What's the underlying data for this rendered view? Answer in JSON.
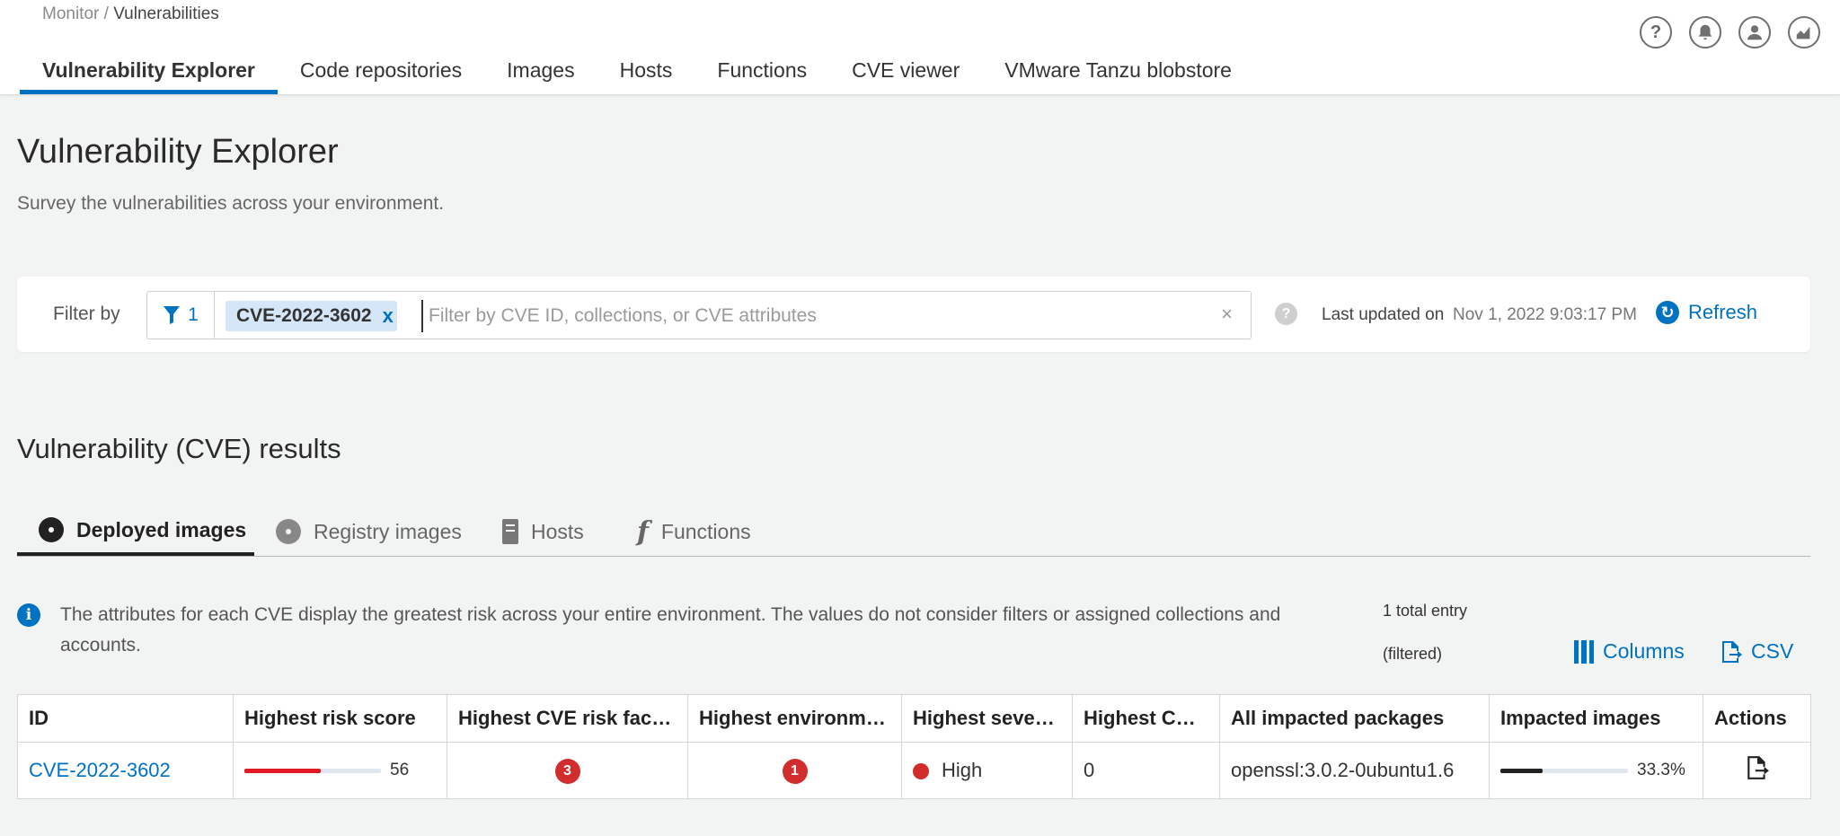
{
  "breadcrumb": {
    "parent": "Monitor",
    "separator": " / ",
    "current": "Vulnerabilities"
  },
  "nav": {
    "tabs": [
      {
        "label": "Vulnerability Explorer",
        "active": true
      },
      {
        "label": "Code repositories"
      },
      {
        "label": "Images"
      },
      {
        "label": "Hosts"
      },
      {
        "label": "Functions"
      },
      {
        "label": "CVE viewer"
      },
      {
        "label": "VMware Tanzu blobstore"
      }
    ]
  },
  "top_icons": [
    "help-icon",
    "bell-icon",
    "user-icon",
    "stats-icon"
  ],
  "page": {
    "title": "Vulnerability Explorer",
    "subtitle": "Survey the vulnerabilities across your environment."
  },
  "filter": {
    "label": "Filter by",
    "count": "1",
    "chip": "CVE-2022-3602",
    "chip_remove": "x",
    "placeholder": "Filter by CVE ID, collections, or CVE attributes",
    "clear": "×",
    "help": "?",
    "last_updated_label": "Last updated on",
    "last_updated_value": "Nov 1, 2022 9:03:17 PM",
    "refresh_label": "Refresh"
  },
  "results": {
    "title": "Vulnerability (CVE) results",
    "tabs": [
      {
        "label": "Deployed images",
        "active": true,
        "icon": "disc-icon"
      },
      {
        "label": "Registry images",
        "icon": "disc-icon"
      },
      {
        "label": "Hosts",
        "icon": "server-icon"
      },
      {
        "label": "Functions",
        "icon": "function-icon"
      }
    ],
    "info_text": "The attributes for each CVE display the greatest risk across your entire environment. The values do not consider filters or assigned collections and accounts.",
    "total_line1": "1 total entry",
    "total_line2": "(filtered)",
    "columns_label": "Columns",
    "csv_label": "CSV"
  },
  "table": {
    "headers": [
      "ID",
      "Highest risk score",
      "Highest CVE risk factors",
      "Highest environme...",
      "Highest severity",
      "Highest CVSS",
      "All impacted packages",
      "Impacted images",
      "Actions"
    ],
    "rows": [
      {
        "id": "CVE-2022-3602",
        "risk_score": "56",
        "risk_score_fraction": 0.56,
        "risk_factors": "3",
        "environmental": "1",
        "severity": "High",
        "cvss": "0",
        "packages": "openssl:3.0.2-0ubuntu1.6",
        "impacted_images": "33.3%",
        "impacted_images_fraction": 0.333
      }
    ]
  },
  "colors": {
    "accent": "#0072c3",
    "danger": "#d12d2d",
    "risk_bar": "#e01b24",
    "impact_bar": "#222222"
  }
}
